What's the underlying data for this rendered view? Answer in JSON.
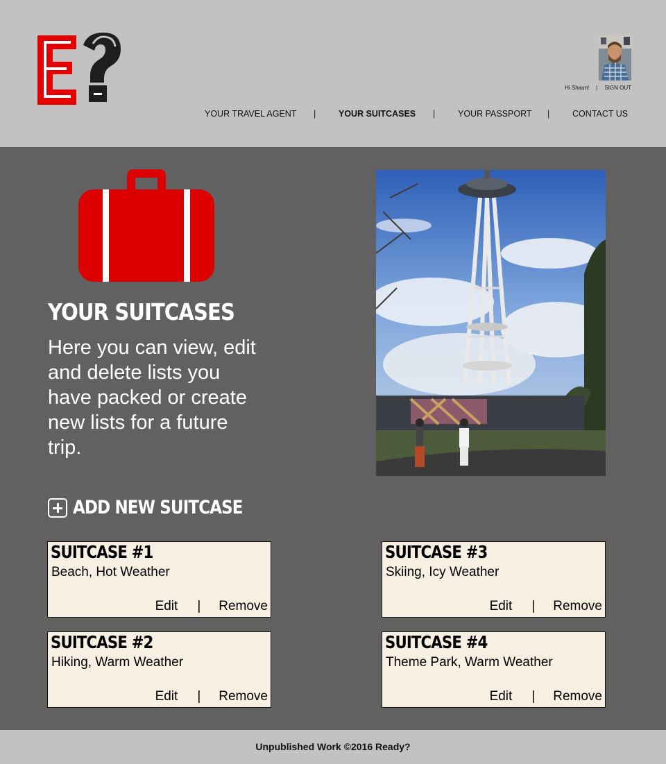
{
  "header": {
    "user_greeting": "Hi Shaun!",
    "user_separator": "|",
    "sign_out": "SIGN OUT",
    "nav": [
      {
        "label": "YOUR TRAVEL AGENT",
        "active": false
      },
      {
        "label": "YOUR SUITCASES",
        "active": true
      },
      {
        "label": "YOUR PASSPORT",
        "active": false
      },
      {
        "label": "CONTACT US",
        "active": false
      }
    ],
    "nav_separator": "|"
  },
  "main": {
    "title": "YOUR SUITCASES",
    "description": "Here you can view, edit and delete lists you have packed or create new lists for a future trip.",
    "add_label": "ADD NEW SUITCASE"
  },
  "suitcases": [
    {
      "title": "SUITCASE #1",
      "desc": "Beach, Hot Weather",
      "edit": "Edit",
      "sep": "|",
      "remove": "Remove"
    },
    {
      "title": "SUITCASE #2",
      "desc": "Hiking, Warm Weather",
      "edit": "Edit",
      "sep": "|",
      "remove": "Remove"
    },
    {
      "title": "SUITCASE #3",
      "desc": "Skiing, Icy Weather",
      "edit": "Edit",
      "sep": "|",
      "remove": "Remove"
    },
    {
      "title": "SUITCASE #4",
      "desc": "Theme Park, Warm Weather",
      "edit": "Edit",
      "sep": "|",
      "remove": "Remove"
    }
  ],
  "footer": {
    "text": "Unpublished Work ©2016 Ready?"
  },
  "colors": {
    "brand_red": "#e60000",
    "header_bg": "#c2c2c2",
    "page_bg": "#616161",
    "card_bg": "#f6efe2"
  },
  "icons": [
    "logo-icon",
    "avatar",
    "suitcase-icon",
    "plus-icon"
  ]
}
